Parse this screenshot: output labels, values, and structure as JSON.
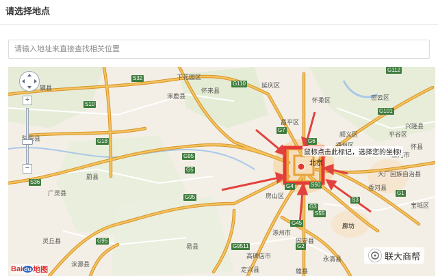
{
  "header": {
    "title": "请选择地点"
  },
  "search": {
    "placeholder": "请输入地址来直接查找相关位置"
  },
  "map": {
    "tooltip": "鼠标点击此标记，选择您的坐标!",
    "logo_text_left": "Bai",
    "logo_text_right": "地图",
    "logo_paw": "du",
    "watermark": "联大商帮",
    "zoom_in": "+",
    "zoom_out": "−",
    "place_labels": [
      "下花园区",
      "涿鹿县",
      "怀来县",
      "镇县",
      "延庆区",
      "怀柔区",
      "密云区",
      "兴隆县",
      "昌平区",
      "顺义区",
      "平谷区",
      "三河市",
      "北京",
      "通州区",
      "大厂回族自治县",
      "香河县",
      "房山区",
      "涿州市",
      "固安县",
      "廊坊",
      "阳原县",
      "蔚县",
      "广灵县",
      "涞源县",
      "易县",
      "高碑店市",
      "永清县",
      "雄县",
      "定兴县",
      "灵丘县",
      "怀县",
      "宝坻区"
    ],
    "highway_labels": [
      "S32",
      "G110",
      "S10",
      "G18",
      "G7",
      "G95",
      "S36",
      "G5",
      "G4",
      "S50",
      "G45",
      "G95",
      "G9511",
      "S55",
      "G3",
      "G1",
      "G112",
      "G101",
      "G2",
      "S3",
      "G6",
      "G95"
    ],
    "colors": {
      "land": "#f3efe6",
      "highway": "#f2b24a",
      "highway_edge": "#d6922a",
      "road": "#ffffff",
      "arrow": "#e2423f",
      "highlight": "#e53935",
      "green_area": "#dfe8cf",
      "city": "#f6d9b0"
    }
  }
}
